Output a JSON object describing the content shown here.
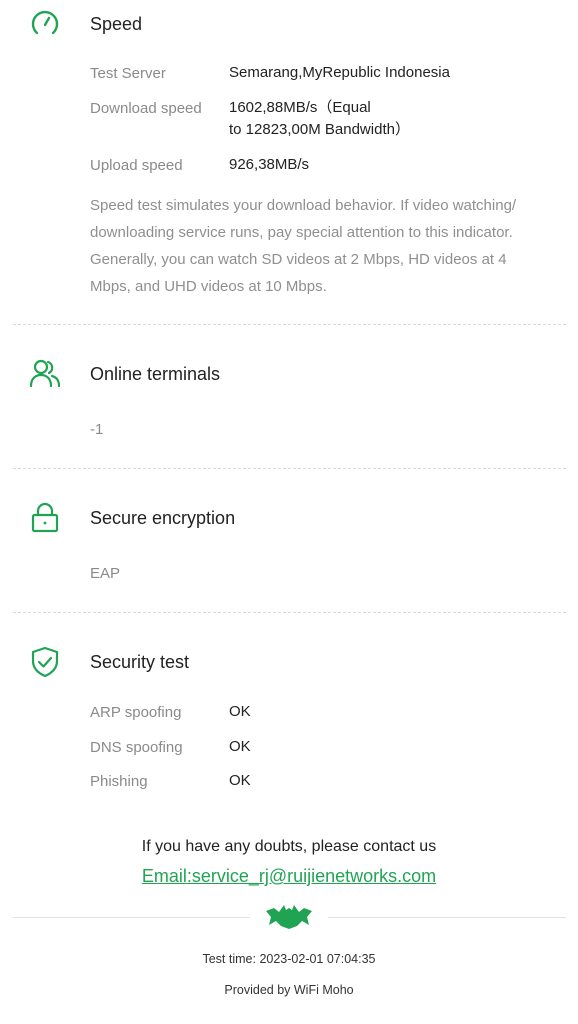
{
  "colors": {
    "accent": "#20a454",
    "muted": "#8a8a8a",
    "divider": "#d9d9d9"
  },
  "speed": {
    "icon": "speedometer-icon",
    "title": "Speed",
    "rows": [
      {
        "label": "Test Server",
        "value": "Semarang,MyRepublic Indonesia"
      },
      {
        "label": "Download speed",
        "value_line1": "1602,88MB/s（Equal",
        "value_line2": "to 12823,00M Bandwidth）"
      },
      {
        "label": "Upload speed",
        "value": "926,38MB/s"
      }
    ],
    "description": "Speed test simulates your download behavior. If video watching/ downloading service runs, pay special attention to this indicator. Generally, you can watch SD videos at 2 Mbps, HD videos at 4 Mbps, and UHD videos at 10 Mbps."
  },
  "terminals": {
    "icon": "users-icon",
    "title": "Online terminals",
    "value": "-1"
  },
  "encryption": {
    "icon": "lock-icon",
    "title": "Secure encryption",
    "value": "EAP"
  },
  "security": {
    "icon": "shield-check-icon",
    "title": "Security test",
    "rows": [
      {
        "label": "ARP spoofing",
        "value": "OK"
      },
      {
        "label": "DNS spoofing",
        "value": "OK"
      },
      {
        "label": "Phishing",
        "value": "OK"
      }
    ]
  },
  "footer": {
    "contact_text": "If you have any doubts, please contact us",
    "email_link": "Email:service_rj@ruijienetworks.com",
    "brand_icon": "bat-logo-icon",
    "test_time": "Test time: 2023-02-01 07:04:35",
    "provided_by": "Provided by WiFi Moho"
  }
}
